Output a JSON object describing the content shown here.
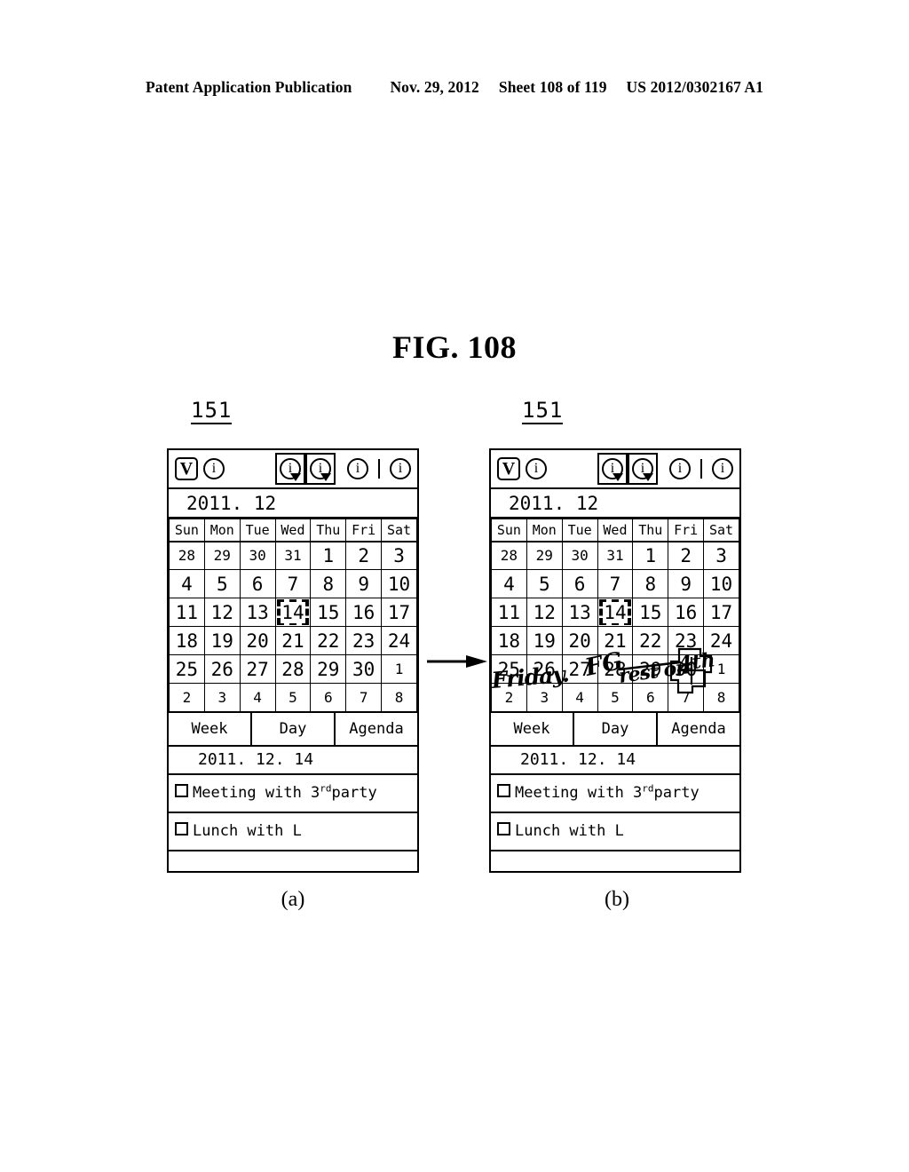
{
  "publication_header": {
    "left": "Patent Application Publication",
    "date": "Nov. 29, 2012",
    "sheet": "Sheet 108 of 119",
    "number": "US 2012/0302167 A1"
  },
  "figure": {
    "title": "FIG. 108",
    "panel_a_letter": "(a)",
    "panel_b_letter": "(b)",
    "ref_label_a": "151",
    "ref_label_b": "151",
    "transition_arrow_icon": "right-arrow-icon"
  },
  "device": {
    "toolbar": {
      "logo_label": "V",
      "logo_icon": "boxed-v-icon",
      "info_icon_1": "circle-i-icon",
      "dropdown_button_1": {
        "icon": "circle-i-icon",
        "label": "i",
        "arrow_icon": "dropdown-arrow-icon"
      },
      "dropdown_button_2": {
        "icon": "circle-i-icon",
        "label": "i",
        "arrow_icon": "dropdown-arrow-icon"
      },
      "info_icon_2": "circle-i-icon",
      "separator_icon": "vertical-separator-icon",
      "info_icon_3": "circle-i-icon",
      "icon_glyph": "i"
    },
    "month_header": "2011.  12",
    "calendar": {
      "weekday_headers": [
        "Sun",
        "Mon",
        "Tue",
        "Wed",
        "Thu",
        "Fri",
        "Sat"
      ],
      "weeks": [
        [
          {
            "day": "28",
            "dim": true,
            "selected": false
          },
          {
            "day": "29",
            "dim": true,
            "selected": false
          },
          {
            "day": "30",
            "dim": true,
            "selected": false
          },
          {
            "day": "31",
            "dim": true,
            "selected": false
          },
          {
            "day": "1",
            "dim": false,
            "selected": false
          },
          {
            "day": "2",
            "dim": false,
            "selected": false
          },
          {
            "day": "3",
            "dim": false,
            "selected": false
          }
        ],
        [
          {
            "day": "4",
            "dim": false,
            "selected": false
          },
          {
            "day": "5",
            "dim": false,
            "selected": false
          },
          {
            "day": "6",
            "dim": false,
            "selected": false
          },
          {
            "day": "7",
            "dim": false,
            "selected": false
          },
          {
            "day": "8",
            "dim": false,
            "selected": false
          },
          {
            "day": "9",
            "dim": false,
            "selected": false
          },
          {
            "day": "10",
            "dim": false,
            "selected": false
          }
        ],
        [
          {
            "day": "11",
            "dim": false,
            "selected": false
          },
          {
            "day": "12",
            "dim": false,
            "selected": false
          },
          {
            "day": "13",
            "dim": false,
            "selected": false
          },
          {
            "day": "14",
            "dim": false,
            "selected": true
          },
          {
            "day": "15",
            "dim": false,
            "selected": false
          },
          {
            "day": "16",
            "dim": false,
            "selected": false
          },
          {
            "day": "17",
            "dim": false,
            "selected": false
          }
        ],
        [
          {
            "day": "18",
            "dim": false,
            "selected": false
          },
          {
            "day": "19",
            "dim": false,
            "selected": false
          },
          {
            "day": "20",
            "dim": false,
            "selected": false
          },
          {
            "day": "21",
            "dim": false,
            "selected": false
          },
          {
            "day": "22",
            "dim": false,
            "selected": false
          },
          {
            "day": "23",
            "dim": false,
            "selected": false
          },
          {
            "day": "24",
            "dim": false,
            "selected": false
          }
        ],
        [
          {
            "day": "25",
            "dim": false,
            "selected": false
          },
          {
            "day": "26",
            "dim": false,
            "selected": false
          },
          {
            "day": "27",
            "dim": false,
            "selected": false
          },
          {
            "day": "28",
            "dim": false,
            "selected": false
          },
          {
            "day": "29",
            "dim": false,
            "selected": false
          },
          {
            "day": "30",
            "dim": false,
            "selected": false
          },
          {
            "day": "1",
            "dim": true,
            "selected": false
          }
        ],
        [
          {
            "day": "2",
            "dim": true,
            "selected": false
          },
          {
            "day": "3",
            "dim": true,
            "selected": false
          },
          {
            "day": "4",
            "dim": true,
            "selected": false
          },
          {
            "day": "5",
            "dim": true,
            "selected": false
          },
          {
            "day": "6",
            "dim": true,
            "selected": false
          },
          {
            "day": "7",
            "dim": true,
            "selected": false
          },
          {
            "day": "8",
            "dim": true,
            "selected": false
          }
        ]
      ]
    },
    "tabs": [
      {
        "label": "Week"
      },
      {
        "label": "Day"
      },
      {
        "label": "Agenda"
      }
    ],
    "selected_date": "2011. 12.  14",
    "events": [
      {
        "checked": false,
        "text_before": "Meeting with 3",
        "superscript": "rd",
        "text_after": "party"
      },
      {
        "checked": false,
        "text_before": "Lunch with L",
        "superscript": "",
        "text_after": ""
      }
    ]
  },
  "handwriting": {
    "word_1": "Friday.",
    "word_2": "FG",
    "word_3": "rest on",
    "word_4": "4th",
    "ink_color": "#000000"
  }
}
